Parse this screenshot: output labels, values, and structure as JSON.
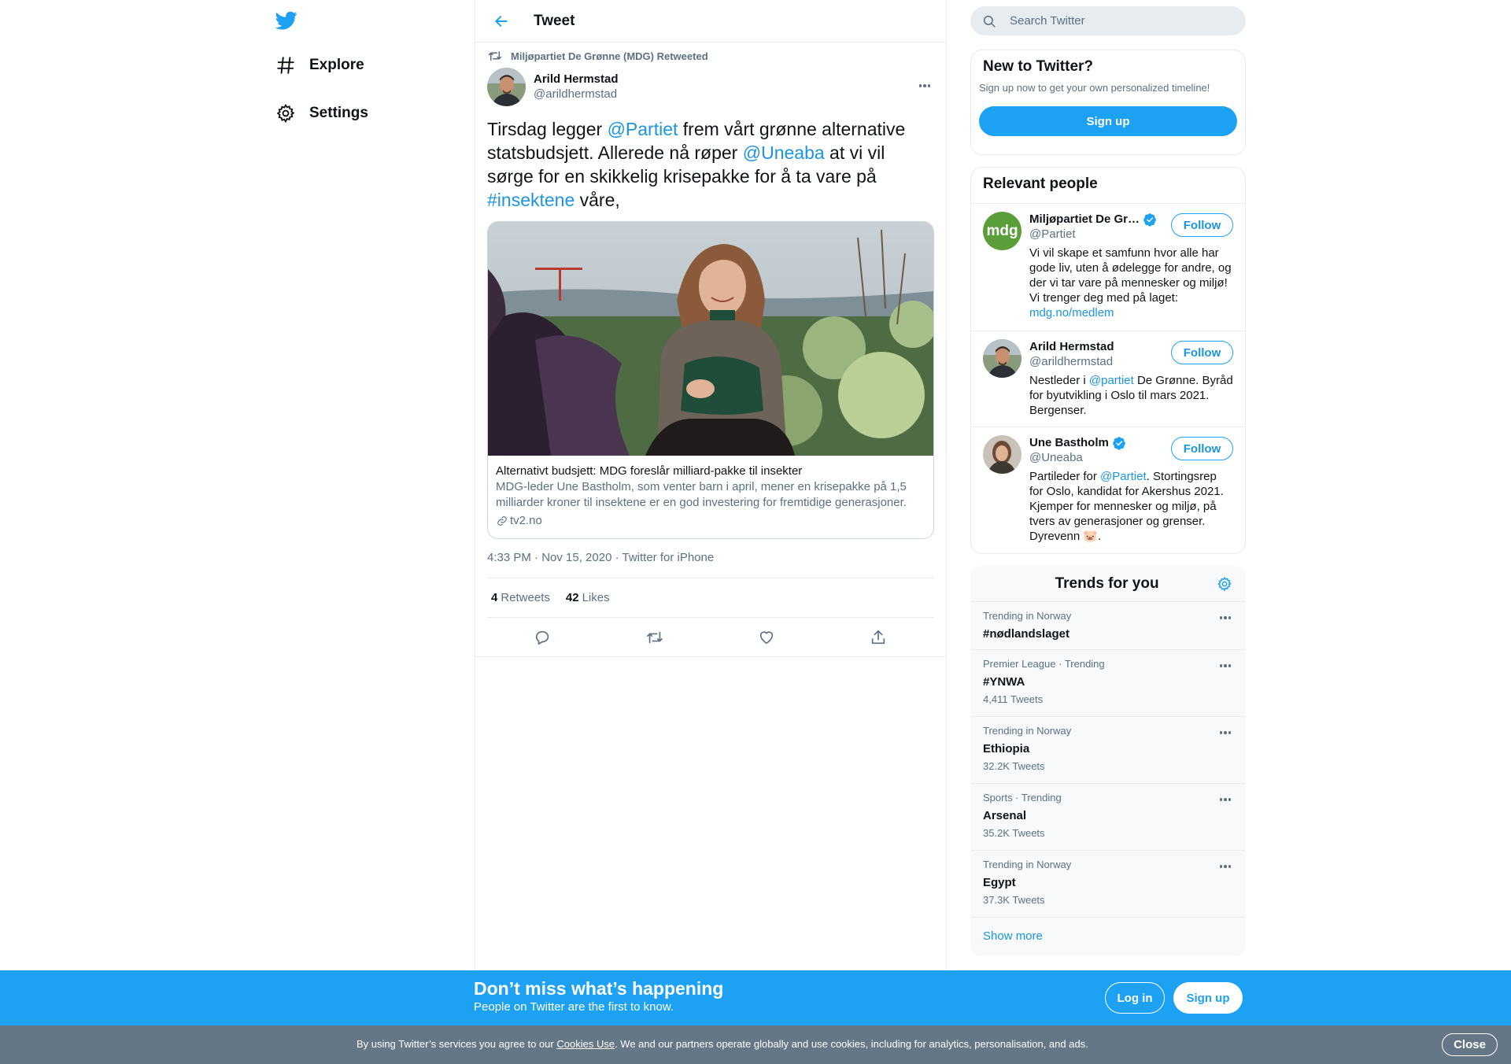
{
  "nav": {
    "logo_icon": "twitter-bird-icon",
    "items": [
      {
        "label": "Explore",
        "icon": "hashtag-icon"
      },
      {
        "label": "Settings",
        "icon": "gear-icon"
      }
    ]
  },
  "header": {
    "title": "Tweet"
  },
  "tweet": {
    "retweeted_by": "Miljøpartiet De Grønne (MDG) Retweeted",
    "author": {
      "name": "Arild Hermstad",
      "handle": "@arildhermstad"
    },
    "text": {
      "p1": "Tirsdag legger ",
      "m1": "@Partiet",
      "p2": " frem vårt grønne alternative statsbudsjett. Allerede nå røper ",
      "m2": "@Uneaba",
      "p3": " at vi vil sørge for en skikkelig krisepakke for å ta vare på ",
      "h1": "#insektene",
      "p4": " våre,"
    },
    "card": {
      "title": "Alternativt budsjett: MDG foreslår milliard-pakke til insekter",
      "description": "MDG-leder Une Bastholm, som venter barn i april, mener en krisepakke på 1,5 milliarder kroner til insektene er en god investering for fremtidige generasjoner.",
      "domain": "tv2.no"
    },
    "meta": "4:33 PM · Nov 15, 2020 · Twitter for iPhone",
    "stats": {
      "retweets_count": "4",
      "retweets_label": "Retweets",
      "likes_count": "42",
      "likes_label": "Likes"
    }
  },
  "search": {
    "placeholder": "Search Twitter"
  },
  "new_to_twitter": {
    "title": "New to Twitter?",
    "description": "Sign up now to get your own personalized timeline!",
    "button": "Sign up"
  },
  "relevant": {
    "title": "Relevant people",
    "follow_label": "Follow",
    "people": [
      {
        "name": "Miljøpartiet De Gr…",
        "handle": "@Partiet",
        "verified": true,
        "bio": "Vi vil skape et samfunn hvor alle har gode liv, uten å ødelegge for andre, og der vi tar vare på mennesker og miljø! Vi trenger deg med på laget: ",
        "bio_link": "mdg.no/medlem",
        "avatar_text": "mdg"
      },
      {
        "name": "Arild Hermstad",
        "handle": "@arildhermstad",
        "verified": false,
        "bio_a": "Nestleder i ",
        "bio_link": "@partiet",
        "bio_b": " De Grønne. Byråd for byutvikling i Oslo til mars 2021. Bergenser."
      },
      {
        "name": "Une Bastholm",
        "handle": "@Uneaba",
        "verified": true,
        "bio_a": "Partileder for ",
        "bio_link": "@Partiet",
        "bio_b": ". Stortingsrep for Oslo, kandidat for Akershus 2021. Kjemper for mennesker og miljø, på tvers av generasjoner og grenser. Dyrevenn 🐷."
      }
    ]
  },
  "trends": {
    "title": "Trends for you",
    "items": [
      {
        "context": "Trending in Norway",
        "name": "#nødlandslaget",
        "count": ""
      },
      {
        "context": "Premier League · Trending",
        "name": "#YNWA",
        "count": "4,411 Tweets"
      },
      {
        "context": "Trending in Norway",
        "name": "Ethiopia",
        "count": "32.2K Tweets"
      },
      {
        "context": "Sports · Trending",
        "name": "Arsenal",
        "count": "35.2K Tweets"
      },
      {
        "context": "Trending in Norway",
        "name": "Egypt",
        "count": "37.3K Tweets"
      }
    ],
    "show_more": "Show more"
  },
  "banner": {
    "title": "Don’t miss what’s happening",
    "subtitle": "People on Twitter are the first to know.",
    "login": "Log in",
    "signup": "Sign up"
  },
  "cookies": {
    "text_a": "By using Twitter’s services you agree to our ",
    "link": "Cookies Use",
    "text_b": ". We and our partners operate globally and use cookies, including for analytics, personalisation, and ads.",
    "close": "Close"
  },
  "colors": {
    "accent": "#1da1f2",
    "link": "#1b95e0",
    "secondary_text": "#5b7083",
    "cookie_bar": "#657786"
  }
}
